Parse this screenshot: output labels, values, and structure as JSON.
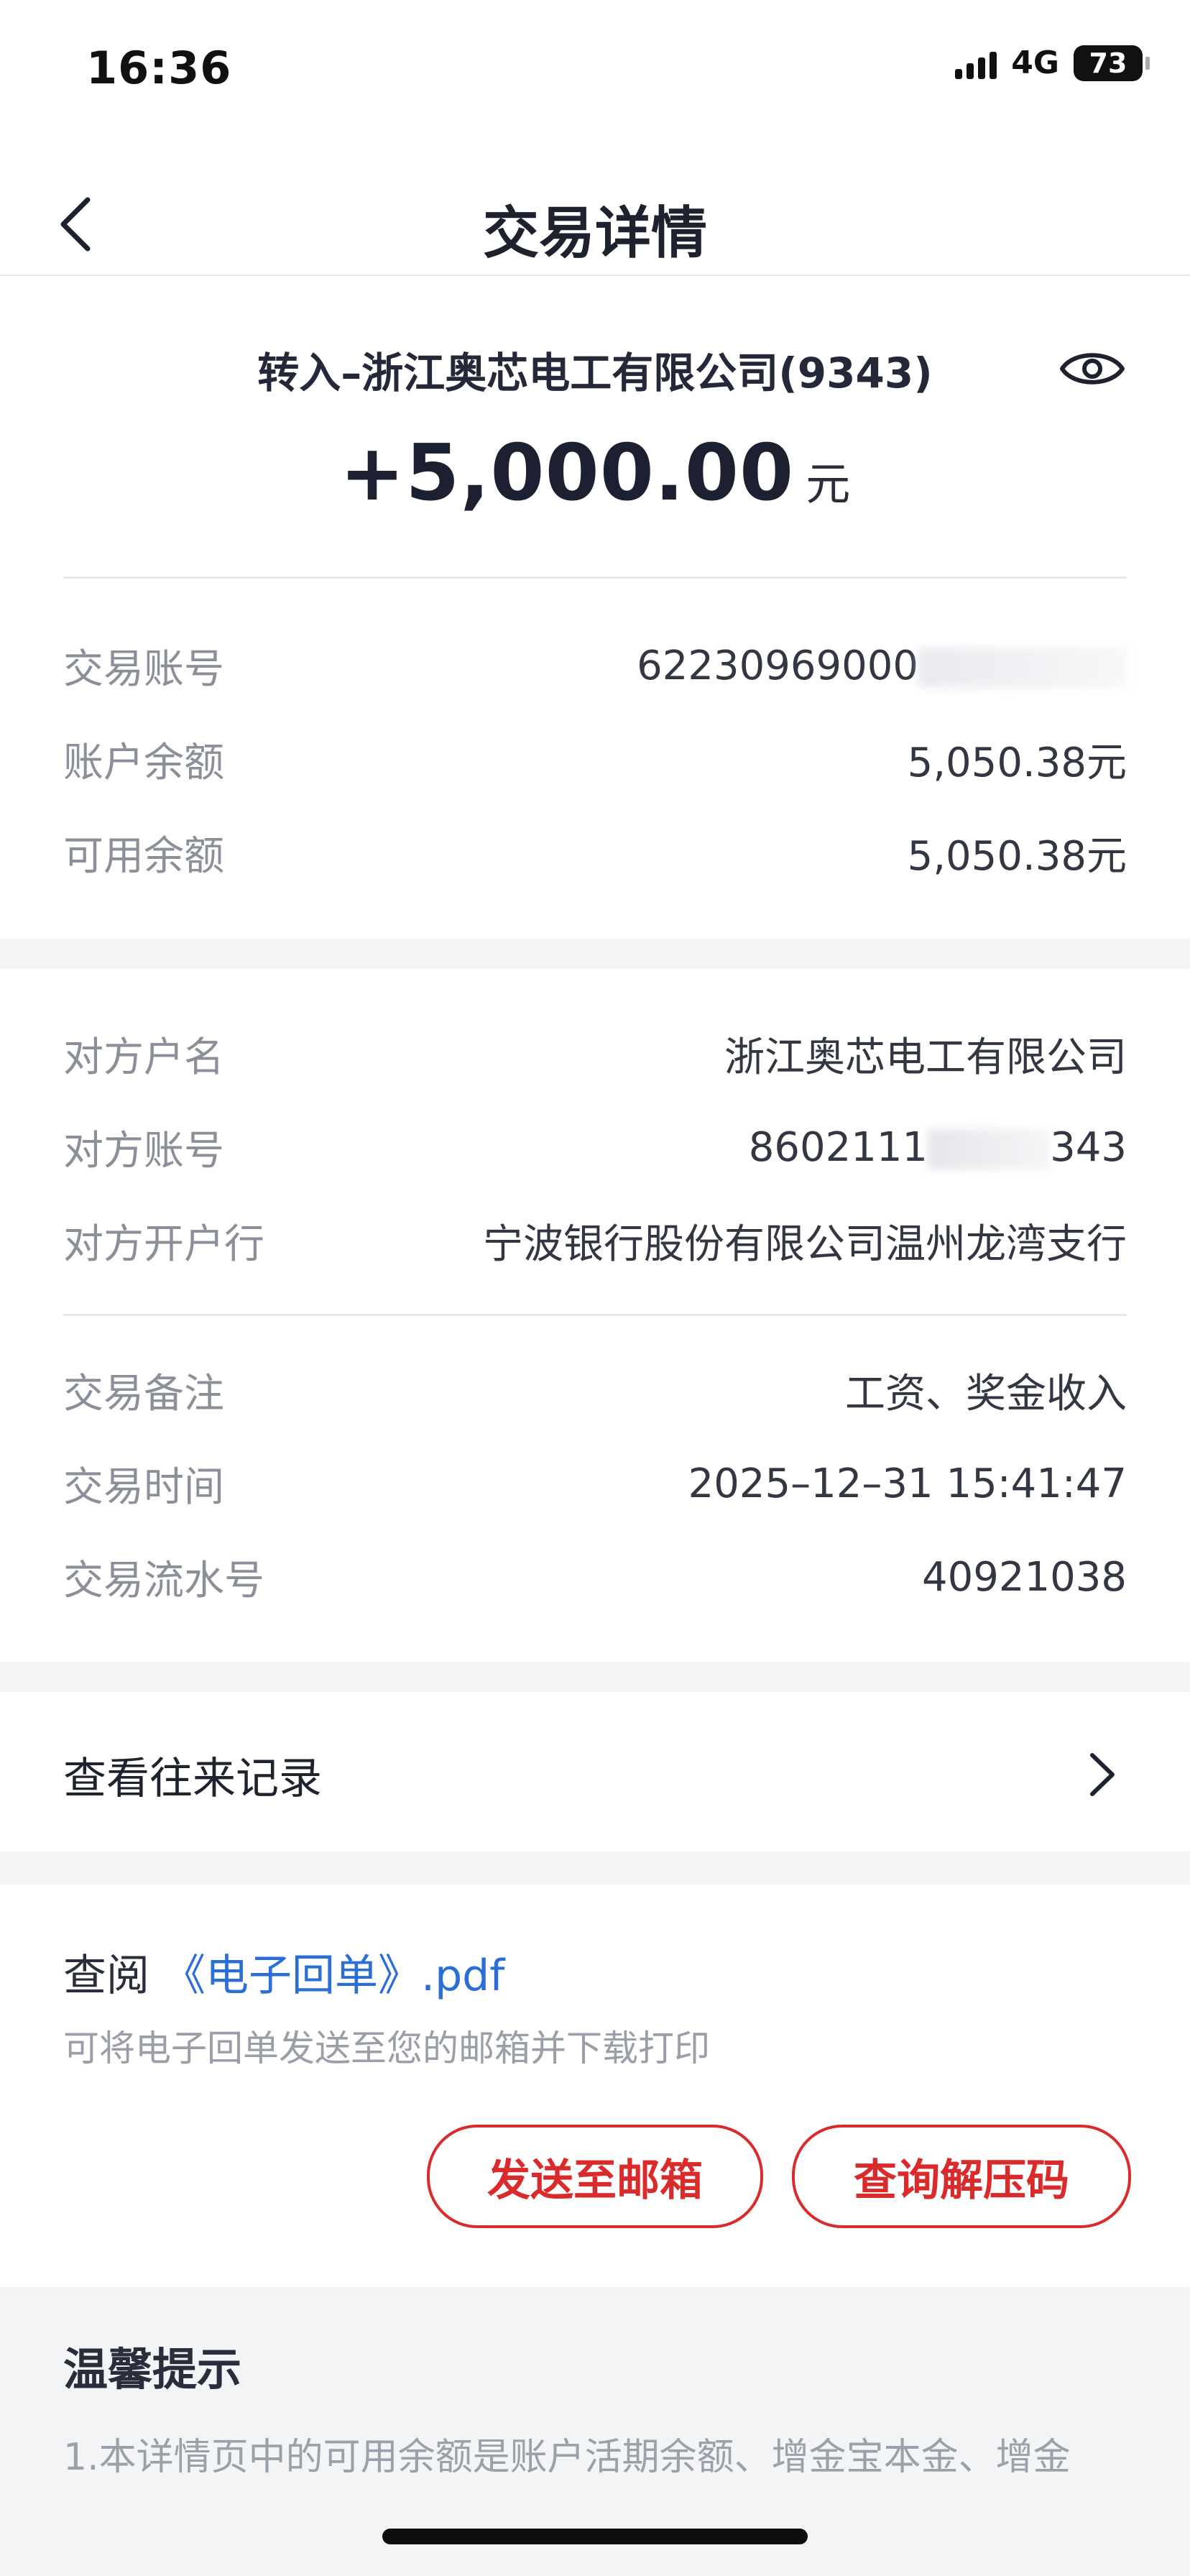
{
  "status_bar": {
    "time": "16:36",
    "network": "4G",
    "battery": "73"
  },
  "nav": {
    "title": "交易详情"
  },
  "header": {
    "title": "转入–浙江奥芯电工有限公司(9343)",
    "amount": "+5,000.00",
    "currency_unit": "元"
  },
  "account": {
    "rows": [
      {
        "label": "交易账号",
        "value": "62230969000"
      },
      {
        "label": "账户余额",
        "value": "5,050.38元"
      },
      {
        "label": "可用余额",
        "value": "5,050.38元"
      }
    ]
  },
  "counterparty": {
    "rows": [
      {
        "label": "对方户名",
        "value": "浙江奥芯电工有限公司"
      },
      {
        "label": "对方账号",
        "value_start": "8602111",
        "value_end": "343"
      },
      {
        "label": "对方开户行",
        "value": "宁波银行股份有限公司温州龙湾支行"
      }
    ]
  },
  "transaction": {
    "rows": [
      {
        "label": "交易备注",
        "value": "工资、奖金收入"
      },
      {
        "label": "交易时间",
        "value": "2025–12–31 15:41:47"
      },
      {
        "label": "交易流水号",
        "value": "40921038"
      }
    ]
  },
  "records": {
    "label": "查看往来记录"
  },
  "receipt": {
    "prefix": "查阅",
    "link": "《电子回单》.pdf",
    "description": "可将电子回单发送至您的邮箱并下载打印",
    "send_button": "发送至邮箱",
    "code_button": "查询解压码"
  },
  "tips": {
    "title": "温馨提示",
    "text": "1.本详情页中的可用余额是账户活期余额、增金宝本金、增金"
  }
}
